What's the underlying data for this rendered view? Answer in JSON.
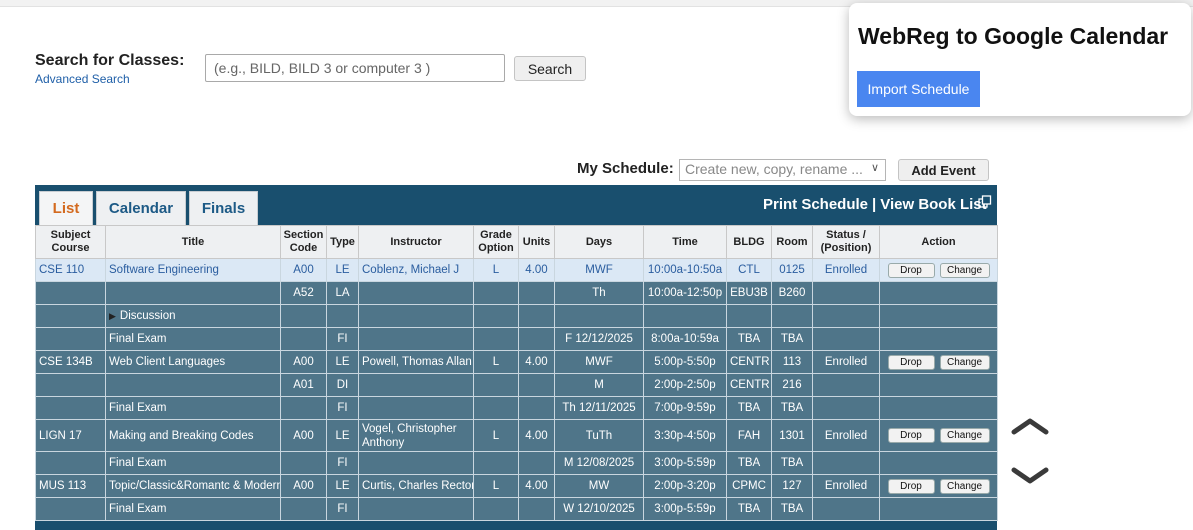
{
  "search": {
    "label": "Search for Classes:",
    "advanced_link": "Advanced Search",
    "placeholder": "(e.g., BILD, BILD 3 or computer 3 )",
    "button": "Search"
  },
  "extension": {
    "title": "WebReg to Google Calendar",
    "import_button": "Import Schedule"
  },
  "my_schedule": {
    "label": "My Schedule:",
    "select_value": "Create new, copy, rename ...",
    "add_event": "Add Event"
  },
  "tabs": [
    {
      "label": "List",
      "active": true
    },
    {
      "label": "Calendar",
      "active": false
    },
    {
      "label": "Finals",
      "active": false
    }
  ],
  "header_links": {
    "print": "Print Schedule",
    "separator": "|",
    "book_list": "View Book List"
  },
  "table": {
    "headers": [
      [
        "Subject",
        "Course"
      ],
      [
        "Title"
      ],
      [
        "Section",
        "Code"
      ],
      [
        "Type"
      ],
      [
        "Instructor"
      ],
      [
        "Grade",
        "Option"
      ],
      [
        "Units"
      ],
      [
        "Days"
      ],
      [
        "Time"
      ],
      [
        "BLDG"
      ],
      [
        "Room"
      ],
      [
        "Status /",
        "(Position)"
      ],
      [
        "Action"
      ]
    ],
    "rows": [
      {
        "subject": "CSE 110",
        "title": "Software Engineering",
        "section": "A00",
        "type": "LE",
        "instructor": "Coblenz, Michael J",
        "grade": "L",
        "units": "4.00",
        "days": "MWF",
        "time": "10:00a-10:50a",
        "bldg": "CTL",
        "room": "0125",
        "status": "Enrolled",
        "drop": "Drop",
        "change": "Change",
        "highlight": true
      },
      {
        "subject": "",
        "title": "",
        "section": "A52",
        "type": "LA",
        "instructor": "",
        "grade": "",
        "units": "",
        "days": "Th",
        "time": "10:00a-12:50p",
        "bldg": "EBU3B",
        "room": "B260",
        "status": ""
      },
      {
        "subject": "",
        "title": "Discussion",
        "section": "",
        "type": "",
        "instructor": "",
        "grade": "",
        "units": "",
        "days": "",
        "time": "",
        "bldg": "",
        "room": "",
        "status": "",
        "expander": true
      },
      {
        "subject": "",
        "title": "Final Exam",
        "section": "",
        "type": "FI",
        "instructor": "",
        "grade": "",
        "units": "",
        "days": "F 12/12/2025",
        "time": "8:00a-10:59a",
        "bldg": "TBA",
        "room": "TBA",
        "status": ""
      },
      {
        "subject": "CSE 134B",
        "title": "Web Client Languages",
        "section": "A00",
        "type": "LE",
        "instructor": "Powell, Thomas Allan",
        "grade": "L",
        "units": "4.00",
        "days": "MWF",
        "time": "5:00p-5:50p",
        "bldg": "CENTR",
        "room": "113",
        "status": "Enrolled",
        "drop": "Drop",
        "change": "Change"
      },
      {
        "subject": "",
        "title": "",
        "section": "A01",
        "type": "DI",
        "instructor": "",
        "grade": "",
        "units": "",
        "days": "M",
        "time": "2:00p-2:50p",
        "bldg": "CENTR",
        "room": "216",
        "status": ""
      },
      {
        "subject": "",
        "title": "Final Exam",
        "section": "",
        "type": "FI",
        "instructor": "",
        "grade": "",
        "units": "",
        "days": "Th 12/11/2025",
        "time": "7:00p-9:59p",
        "bldg": "TBA",
        "room": "TBA",
        "status": ""
      },
      {
        "subject": "LIGN  17",
        "title": "Making and Breaking Codes",
        "section": "A00",
        "type": "LE",
        "instructor": "Vogel, Christopher Anthony",
        "grade": "L",
        "units": "4.00",
        "days": "TuTh",
        "time": "3:30p-4:50p",
        "bldg": "FAH",
        "room": "1301",
        "status": "Enrolled",
        "drop": "Drop",
        "change": "Change",
        "tall": true
      },
      {
        "subject": "",
        "title": "Final Exam",
        "section": "",
        "type": "FI",
        "instructor": "",
        "grade": "",
        "units": "",
        "days": "M 12/08/2025",
        "time": "3:00p-5:59p",
        "bldg": "TBA",
        "room": "TBA",
        "status": ""
      },
      {
        "subject": "MUS 113",
        "title": "Topic/Classic&Romantc & Modern",
        "section": "A00",
        "type": "LE",
        "instructor": "Curtis, Charles Rector",
        "grade": "L",
        "units": "4.00",
        "days": "MW",
        "time": "2:00p-3:20p",
        "bldg": "CPMC",
        "room": "127",
        "status": "Enrolled",
        "drop": "Drop",
        "change": "Change"
      },
      {
        "subject": "",
        "title": "Final Exam",
        "section": "",
        "type": "FI",
        "instructor": "",
        "grade": "",
        "units": "",
        "days": "W 12/10/2025",
        "time": "3:00p-5:59p",
        "bldg": "TBA",
        "room": "TBA",
        "status": ""
      }
    ]
  },
  "scroll_arrows": {
    "up": "chevron-up-icon",
    "down": "chevron-down-icon"
  },
  "colors": {
    "panel_bg": "#194f6e",
    "row_bg": "#4f7589",
    "highlight_row_bg": "#dbe8f5",
    "active_tab": "#d36a1f",
    "extension_button": "#4a86f0"
  }
}
